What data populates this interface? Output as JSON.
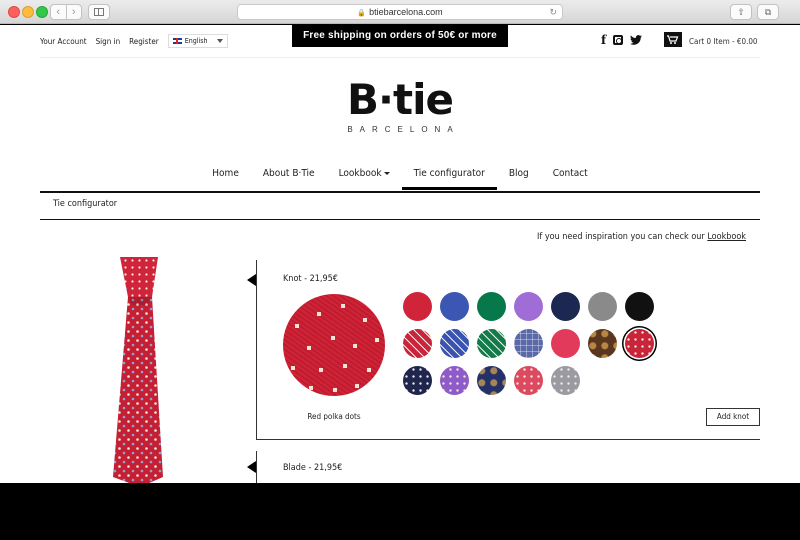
{
  "browser": {
    "url": "btiebarcelona.com"
  },
  "header": {
    "links": [
      "Your Account",
      "Sign in",
      "Register"
    ],
    "language": "English",
    "promo": "Free shipping on orders of 50€ or more",
    "cart": "Cart 0 Item - €0.00"
  },
  "logo": {
    "main": "B·tie",
    "sub": "BARCELONA"
  },
  "nav": {
    "items": [
      "Home",
      "About B·Tie",
      "Lookbook",
      "Tie configurator",
      "Blog",
      "Contact"
    ],
    "active": "Tie configurator"
  },
  "breadcrumb": "Tie configurator",
  "inspiration": {
    "text": "If you need inspiration you can check our",
    "link": "Lookbook"
  },
  "knot": {
    "title": "Knot - 21,95€",
    "selected_name": "Red polka dots",
    "add_label": "Add knot",
    "swatches": [
      {
        "name": "red",
        "color": "#d0243a",
        "pattern": "solid"
      },
      {
        "name": "blue",
        "color": "#3c56b3",
        "pattern": "solid"
      },
      {
        "name": "green",
        "color": "#07784a",
        "pattern": "solid"
      },
      {
        "name": "lilac",
        "color": "#a06dd6",
        "pattern": "solid"
      },
      {
        "name": "navy",
        "color": "#1c2752",
        "pattern": "solid"
      },
      {
        "name": "grey",
        "color": "#8a8a8a",
        "pattern": "solid"
      },
      {
        "name": "black",
        "color": "#111111",
        "pattern": "solid"
      },
      {
        "name": "red-stripes",
        "color": "#c8243a",
        "pattern": "stripe"
      },
      {
        "name": "blue-stripes",
        "color": "#3a52b0",
        "pattern": "stripe"
      },
      {
        "name": "green-stripes",
        "color": "#137a4a",
        "pattern": "stripe"
      },
      {
        "name": "check",
        "color": "#5a6aa8",
        "pattern": "check"
      },
      {
        "name": "pink",
        "color": "#e23a5a",
        "pattern": "solid"
      },
      {
        "name": "brown-paisley",
        "color": "#5a3520",
        "pattern": "paisley"
      },
      {
        "name": "red-dots",
        "color": "#c8243a",
        "pattern": "dots",
        "selected": true
      },
      {
        "name": "navy-dots",
        "color": "#1e2650",
        "pattern": "dots"
      },
      {
        "name": "purple-dots",
        "color": "#8e5bc8",
        "pattern": "dots"
      },
      {
        "name": "navy-paisley",
        "color": "#243068",
        "pattern": "paisley"
      },
      {
        "name": "pink-dots",
        "color": "#dc4a62",
        "pattern": "dots"
      },
      {
        "name": "grey-dots",
        "color": "#9a9aa2",
        "pattern": "dots"
      }
    ]
  },
  "blade": {
    "title": "Blade - 21,95€"
  }
}
